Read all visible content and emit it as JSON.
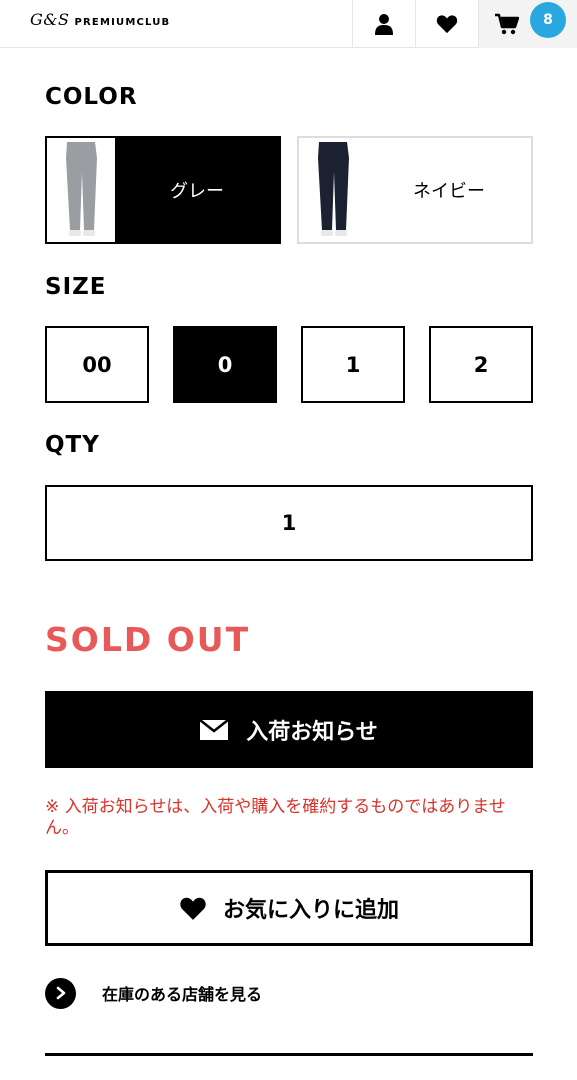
{
  "header": {
    "logo_mark": "G&S",
    "logo_text": "PREMIUMCLUB",
    "cart_count": "8",
    "icons": [
      "user-icon",
      "heart-icon",
      "cart-icon"
    ]
  },
  "color": {
    "label": "COLOR",
    "options": [
      {
        "name": "グレー",
        "selected": true,
        "swatch": "#9a9da1"
      },
      {
        "name": "ネイビー",
        "selected": false,
        "swatch": "#1c2132"
      }
    ]
  },
  "size": {
    "label": "SIZE",
    "options": [
      "00",
      "0",
      "1",
      "2"
    ],
    "selected": "0"
  },
  "qty": {
    "label": "QTY",
    "value": "1"
  },
  "status": {
    "sold_out": "SOLD OUT"
  },
  "actions": {
    "notify_label": "入荷お知らせ",
    "notice": "※ 入荷お知らせは、入荷や購入を確約するものではありません。",
    "favorite_label": "お気に入りに追加",
    "stores_label": "在庫のある店舗を見る"
  },
  "colors": {
    "accent_red": "#e85a5a",
    "notice_red": "#d9332b",
    "badge_blue": "#29a8e0"
  }
}
